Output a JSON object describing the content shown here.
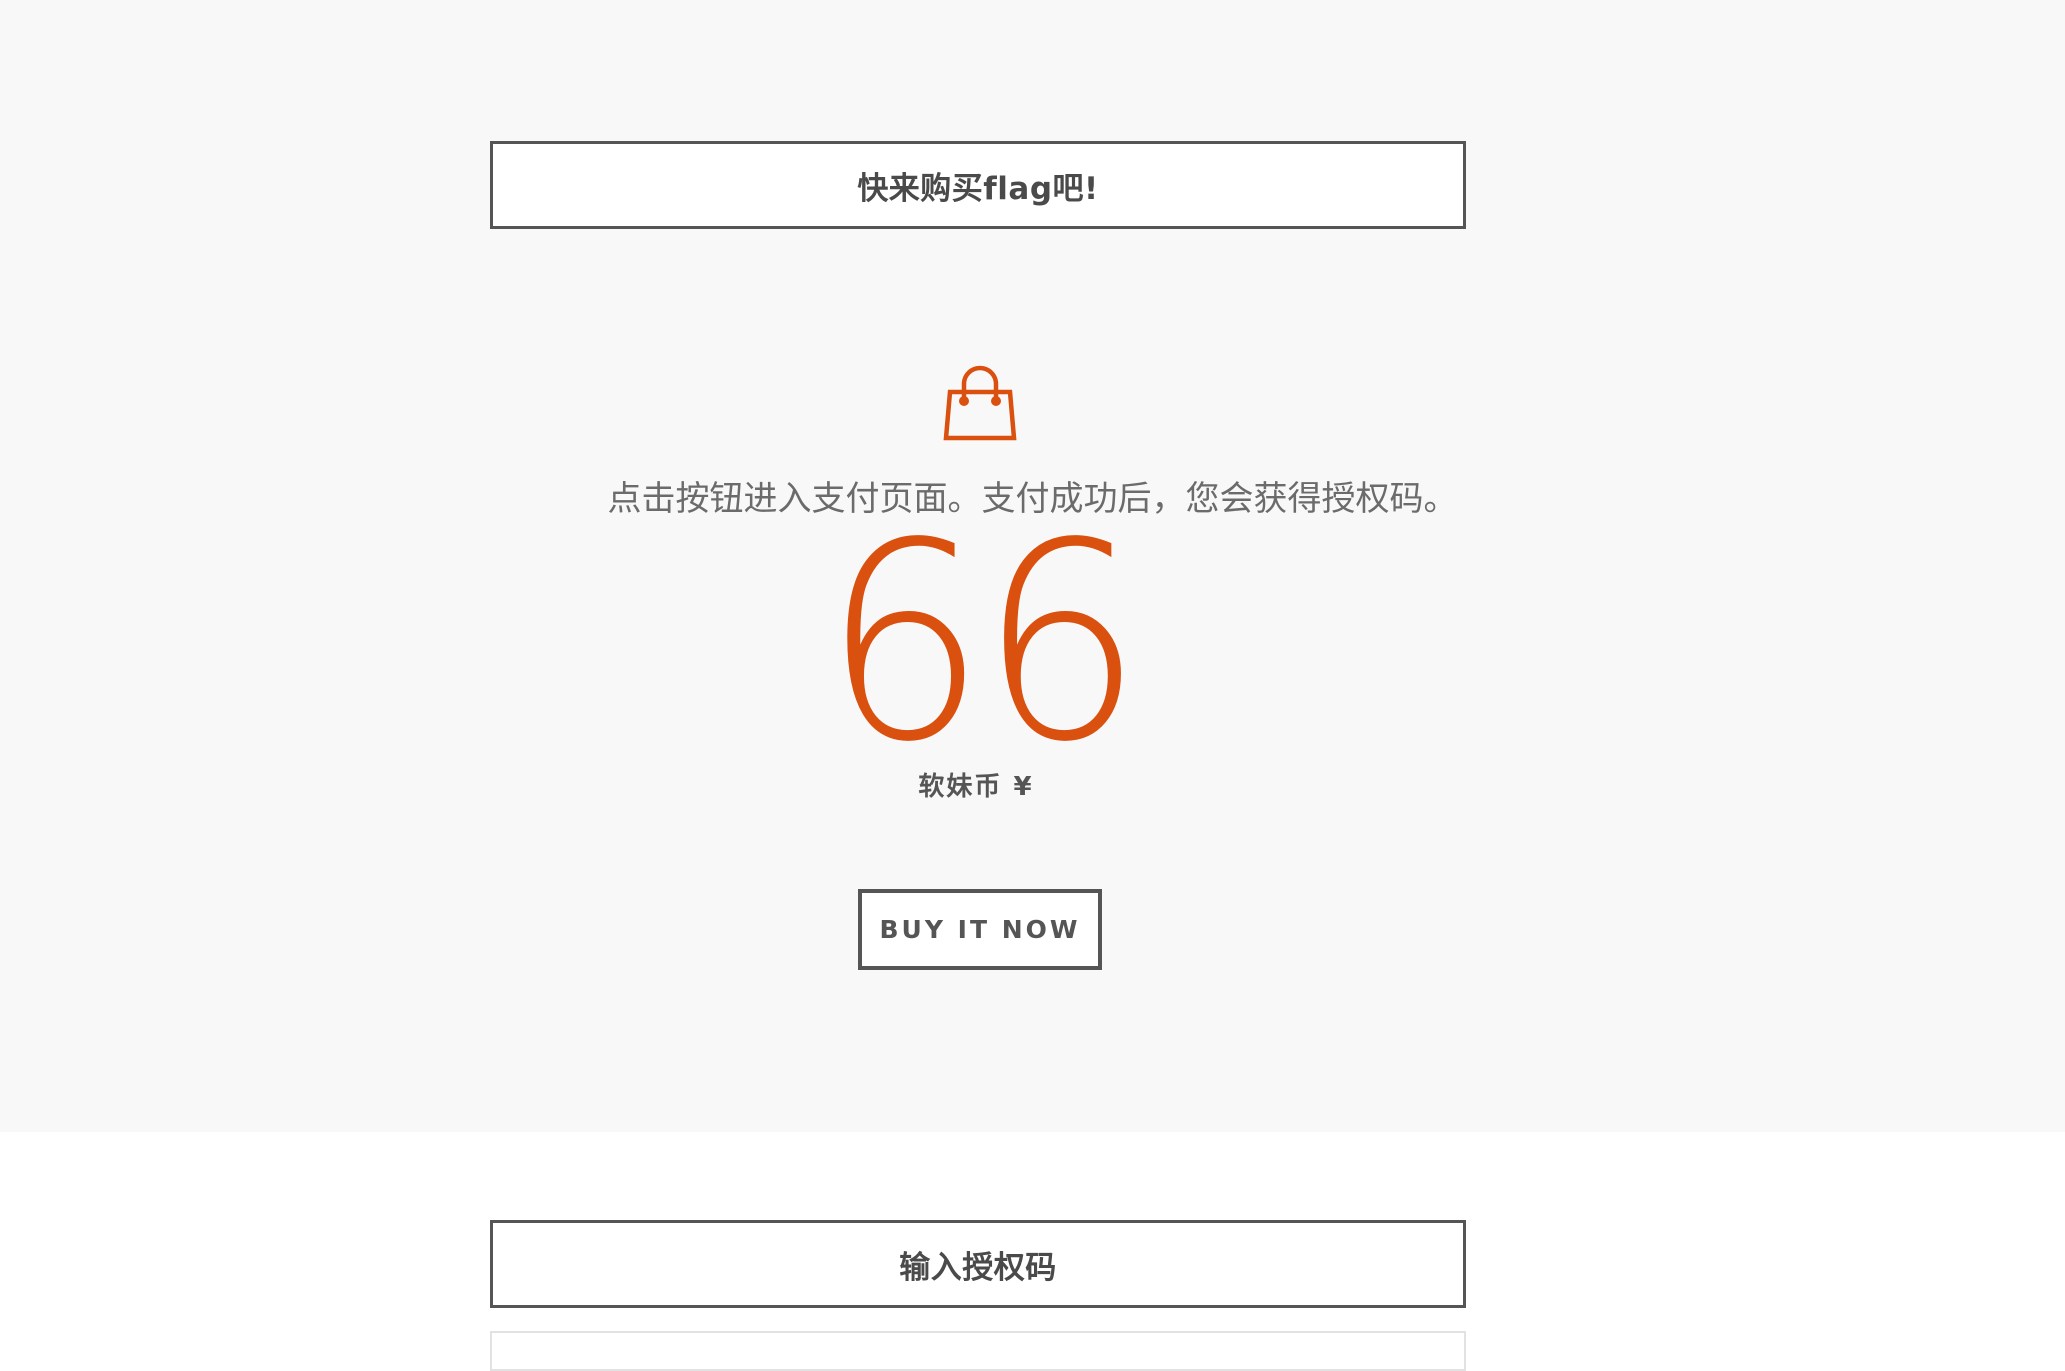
{
  "purchase_section": {
    "title": "快来购买flag吧!",
    "description": "点击按钮进入支付页面。支付成功后，您会获得授权码。",
    "price": "66",
    "currency": "软妹币 ¥",
    "buy_button_label": "BUY IT NOW",
    "icon": "shopping-bag-icon",
    "accent_color": "#d9500f"
  },
  "auth_section": {
    "title": "输入授权码",
    "input_value": ""
  }
}
